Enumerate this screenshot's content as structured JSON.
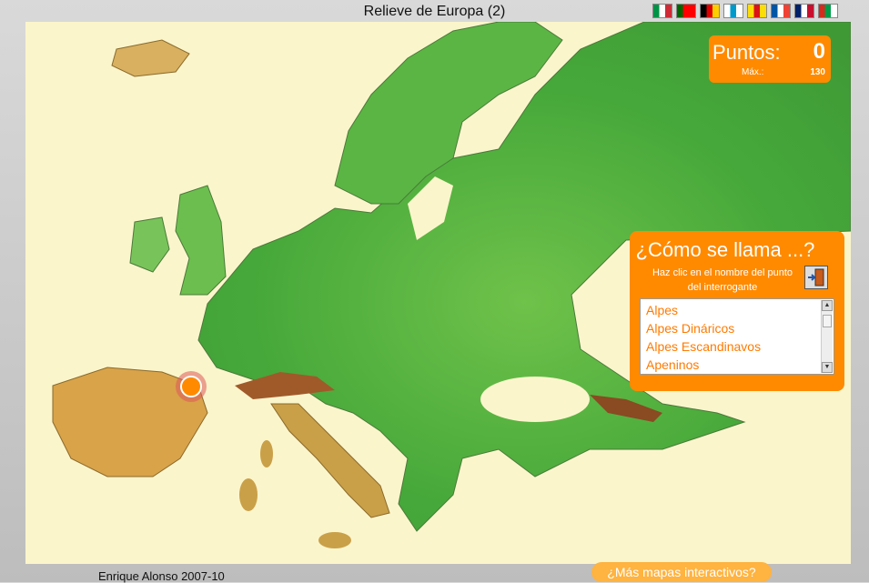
{
  "header": {
    "title": "Relieve de Europa (2)"
  },
  "flags": [
    {
      "name": "italy-flag-icon",
      "colors": [
        "#009246",
        "#ffffff",
        "#ce2b37"
      ]
    },
    {
      "name": "portugal-flag-icon",
      "colors": [
        "#006600",
        "#ff0000",
        "#ff0000"
      ]
    },
    {
      "name": "germany-flag-icon",
      "colors": [
        "#000000",
        "#dd0000",
        "#ffce00"
      ]
    },
    {
      "name": "galicia-flag-icon",
      "colors": [
        "#ffffff",
        "#0099cc",
        "#ffffff"
      ]
    },
    {
      "name": "catalonia-flag-icon",
      "colors": [
        "#fcdd09",
        "#da121a",
        "#fcdd09"
      ]
    },
    {
      "name": "france-flag-icon",
      "colors": [
        "#0055a4",
        "#ffffff",
        "#ef4135"
      ]
    },
    {
      "name": "uk-flag-icon",
      "colors": [
        "#012169",
        "#ffffff",
        "#c8102e"
      ]
    },
    {
      "name": "basque-flag-icon",
      "colors": [
        "#d52b1e",
        "#009b48",
        "#ffffff"
      ]
    }
  ],
  "score": {
    "label": "Puntos:",
    "value": "0",
    "max_label": "Máx.:",
    "max_value": "130"
  },
  "question": {
    "title": "¿Cómo se llama ...?",
    "hint": "Haz clic en el nombre del punto del interrogante",
    "options": [
      "Alpes",
      "Alpes Dináricos",
      "Alpes Escandinavos",
      "Apeninos"
    ]
  },
  "footer": {
    "credit": "Enrique Alonso 2007-10",
    "more_maps": "¿Más mapas interactivos?"
  },
  "colors": {
    "accent": "#ff8a00",
    "sea": "#fbf5cc"
  }
}
